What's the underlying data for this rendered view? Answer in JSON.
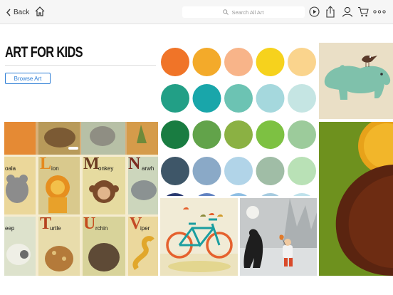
{
  "nav": {
    "back_label": "Back",
    "search_placeholder": "Search All Art"
  },
  "hero": {
    "title": "ART FOR KIDS",
    "browse_label": "Browse Art"
  },
  "alphabet": {
    "rows": [
      [
        {
          "letter": "",
          "word": "oala",
          "bg": "#ebd79a",
          "letter_color": "#000"
        },
        {
          "letter": "L",
          "word": "ion",
          "bg": "#d9c98d",
          "letter_color": "#e58a1e"
        },
        {
          "letter": "M",
          "word": "onkey",
          "bg": "#e6dba0",
          "letter_color": "#6a3b22"
        },
        {
          "letter": "N",
          "word": "arwh",
          "bg": "#ccd6bc",
          "letter_color": "#7b2b1f"
        }
      ],
      [
        {
          "letter": "",
          "word": "eep",
          "bg": "#dde2cc",
          "letter_color": "#000"
        },
        {
          "letter": "T",
          "word": "urtle",
          "bg": "#e8dcab",
          "letter_color": "#b5431f"
        },
        {
          "letter": "U",
          "word": "rchin",
          "bg": "#d8d39a",
          "letter_color": "#c54a1c"
        },
        {
          "letter": "V",
          "word": "iper",
          "bg": "#ebd89d",
          "letter_color": "#c44a26"
        }
      ]
    ]
  },
  "swatches": {
    "rows": [
      [
        "#f07428",
        "#f3aa2a",
        "#f8b489",
        "#f6d21d",
        "#fad48d"
      ],
      [
        "#229f86",
        "#19a6aa",
        "#6cc3b3",
        "#a5d8dd",
        "#c5e5e3"
      ],
      [
        "#197c41",
        "#62a34a",
        "#8bb143",
        "#7dc142",
        "#9ccb9b"
      ],
      [
        "#3e5668",
        "#8aa9c7",
        "#b1d4e8",
        "#a0bda6",
        "#b9e1b6"
      ],
      [
        "#2a3a70",
        "#6283c1",
        "#8fbfe4",
        "#a6cbe0",
        "#bfe2ec"
      ]
    ]
  }
}
